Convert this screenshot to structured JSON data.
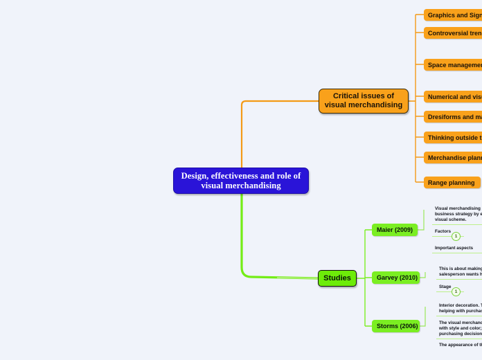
{
  "diagram": {
    "type": "mind-map",
    "background_color": "#f0f3fa",
    "central": {
      "label_line1": "Design, effectiveness and role of",
      "label_line2": "visual merchandising",
      "color": "#2a14d8",
      "text_color": "#ffffff"
    },
    "branches": [
      {
        "id": "critical-issues",
        "label_line1": "Critical issues of",
        "label_line2": "visual merchandising",
        "color": "#f9a11b",
        "children": [
          {
            "label": "Graphics and Signage"
          },
          {
            "label": "Controversial trends"
          },
          {
            "label": "Space management"
          },
          {
            "label": "Numerical and visual"
          },
          {
            "label": "Dresiforms and man"
          },
          {
            "label": "Thinking outside the"
          },
          {
            "label": "Merchandise planning"
          },
          {
            "label": "Range planning"
          }
        ]
      },
      {
        "id": "studies",
        "label": "Studies",
        "color": "#6dec09",
        "children": [
          {
            "label": "Maier (2009)",
            "details": [
              {
                "text": "Visual merchandising a\nbusiness strategy by ex\nvisual scheme.",
                "badge": null
              },
              {
                "text": "Factors",
                "badge": "1"
              },
              {
                "text": "Important aspects",
                "badge": null
              }
            ]
          },
          {
            "label": "Garvey (2010)",
            "details": [
              {
                "text": "This is about making\nsalesperson wants hi",
                "badge": null
              },
              {
                "text": "Stage",
                "badge": "1"
              }
            ]
          },
          {
            "label": "Storms (2006)",
            "details": [
              {
                "text": "Interior decoration. T\nhelping with purchas",
                "badge": null
              },
              {
                "text": "The visual merchandi\nwith style and color; \npurchasing decisions",
                "badge": null
              },
              {
                "text": "The appearance of th",
                "badge": null
              }
            ]
          }
        ]
      }
    ]
  }
}
